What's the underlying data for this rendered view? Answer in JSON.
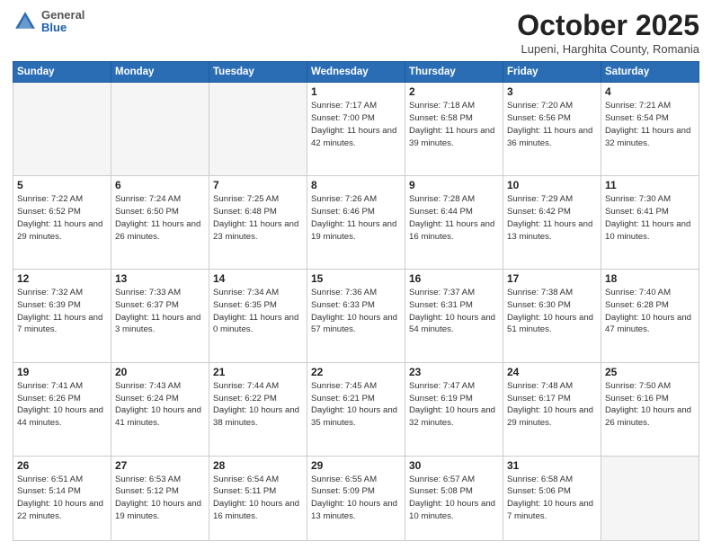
{
  "header": {
    "logo_general": "General",
    "logo_blue": "Blue",
    "month": "October 2025",
    "location": "Lupeni, Harghita County, Romania"
  },
  "weekdays": [
    "Sunday",
    "Monday",
    "Tuesday",
    "Wednesday",
    "Thursday",
    "Friday",
    "Saturday"
  ],
  "weeks": [
    [
      {
        "day": "",
        "info": ""
      },
      {
        "day": "",
        "info": ""
      },
      {
        "day": "",
        "info": ""
      },
      {
        "day": "1",
        "info": "Sunrise: 7:17 AM\nSunset: 7:00 PM\nDaylight: 11 hours\nand 42 minutes."
      },
      {
        "day": "2",
        "info": "Sunrise: 7:18 AM\nSunset: 6:58 PM\nDaylight: 11 hours\nand 39 minutes."
      },
      {
        "day": "3",
        "info": "Sunrise: 7:20 AM\nSunset: 6:56 PM\nDaylight: 11 hours\nand 36 minutes."
      },
      {
        "day": "4",
        "info": "Sunrise: 7:21 AM\nSunset: 6:54 PM\nDaylight: 11 hours\nand 32 minutes."
      }
    ],
    [
      {
        "day": "5",
        "info": "Sunrise: 7:22 AM\nSunset: 6:52 PM\nDaylight: 11 hours\nand 29 minutes."
      },
      {
        "day": "6",
        "info": "Sunrise: 7:24 AM\nSunset: 6:50 PM\nDaylight: 11 hours\nand 26 minutes."
      },
      {
        "day": "7",
        "info": "Sunrise: 7:25 AM\nSunset: 6:48 PM\nDaylight: 11 hours\nand 23 minutes."
      },
      {
        "day": "8",
        "info": "Sunrise: 7:26 AM\nSunset: 6:46 PM\nDaylight: 11 hours\nand 19 minutes."
      },
      {
        "day": "9",
        "info": "Sunrise: 7:28 AM\nSunset: 6:44 PM\nDaylight: 11 hours\nand 16 minutes."
      },
      {
        "day": "10",
        "info": "Sunrise: 7:29 AM\nSunset: 6:42 PM\nDaylight: 11 hours\nand 13 minutes."
      },
      {
        "day": "11",
        "info": "Sunrise: 7:30 AM\nSunset: 6:41 PM\nDaylight: 11 hours\nand 10 minutes."
      }
    ],
    [
      {
        "day": "12",
        "info": "Sunrise: 7:32 AM\nSunset: 6:39 PM\nDaylight: 11 hours\nand 7 minutes."
      },
      {
        "day": "13",
        "info": "Sunrise: 7:33 AM\nSunset: 6:37 PM\nDaylight: 11 hours\nand 3 minutes."
      },
      {
        "day": "14",
        "info": "Sunrise: 7:34 AM\nSunset: 6:35 PM\nDaylight: 11 hours\nand 0 minutes."
      },
      {
        "day": "15",
        "info": "Sunrise: 7:36 AM\nSunset: 6:33 PM\nDaylight: 10 hours\nand 57 minutes."
      },
      {
        "day": "16",
        "info": "Sunrise: 7:37 AM\nSunset: 6:31 PM\nDaylight: 10 hours\nand 54 minutes."
      },
      {
        "day": "17",
        "info": "Sunrise: 7:38 AM\nSunset: 6:30 PM\nDaylight: 10 hours\nand 51 minutes."
      },
      {
        "day": "18",
        "info": "Sunrise: 7:40 AM\nSunset: 6:28 PM\nDaylight: 10 hours\nand 47 minutes."
      }
    ],
    [
      {
        "day": "19",
        "info": "Sunrise: 7:41 AM\nSunset: 6:26 PM\nDaylight: 10 hours\nand 44 minutes."
      },
      {
        "day": "20",
        "info": "Sunrise: 7:43 AM\nSunset: 6:24 PM\nDaylight: 10 hours\nand 41 minutes."
      },
      {
        "day": "21",
        "info": "Sunrise: 7:44 AM\nSunset: 6:22 PM\nDaylight: 10 hours\nand 38 minutes."
      },
      {
        "day": "22",
        "info": "Sunrise: 7:45 AM\nSunset: 6:21 PM\nDaylight: 10 hours\nand 35 minutes."
      },
      {
        "day": "23",
        "info": "Sunrise: 7:47 AM\nSunset: 6:19 PM\nDaylight: 10 hours\nand 32 minutes."
      },
      {
        "day": "24",
        "info": "Sunrise: 7:48 AM\nSunset: 6:17 PM\nDaylight: 10 hours\nand 29 minutes."
      },
      {
        "day": "25",
        "info": "Sunrise: 7:50 AM\nSunset: 6:16 PM\nDaylight: 10 hours\nand 26 minutes."
      }
    ],
    [
      {
        "day": "26",
        "info": "Sunrise: 6:51 AM\nSunset: 5:14 PM\nDaylight: 10 hours\nand 22 minutes."
      },
      {
        "day": "27",
        "info": "Sunrise: 6:53 AM\nSunset: 5:12 PM\nDaylight: 10 hours\nand 19 minutes."
      },
      {
        "day": "28",
        "info": "Sunrise: 6:54 AM\nSunset: 5:11 PM\nDaylight: 10 hours\nand 16 minutes."
      },
      {
        "day": "29",
        "info": "Sunrise: 6:55 AM\nSunset: 5:09 PM\nDaylight: 10 hours\nand 13 minutes."
      },
      {
        "day": "30",
        "info": "Sunrise: 6:57 AM\nSunset: 5:08 PM\nDaylight: 10 hours\nand 10 minutes."
      },
      {
        "day": "31",
        "info": "Sunrise: 6:58 AM\nSunset: 5:06 PM\nDaylight: 10 hours\nand 7 minutes."
      },
      {
        "day": "",
        "info": ""
      }
    ]
  ]
}
